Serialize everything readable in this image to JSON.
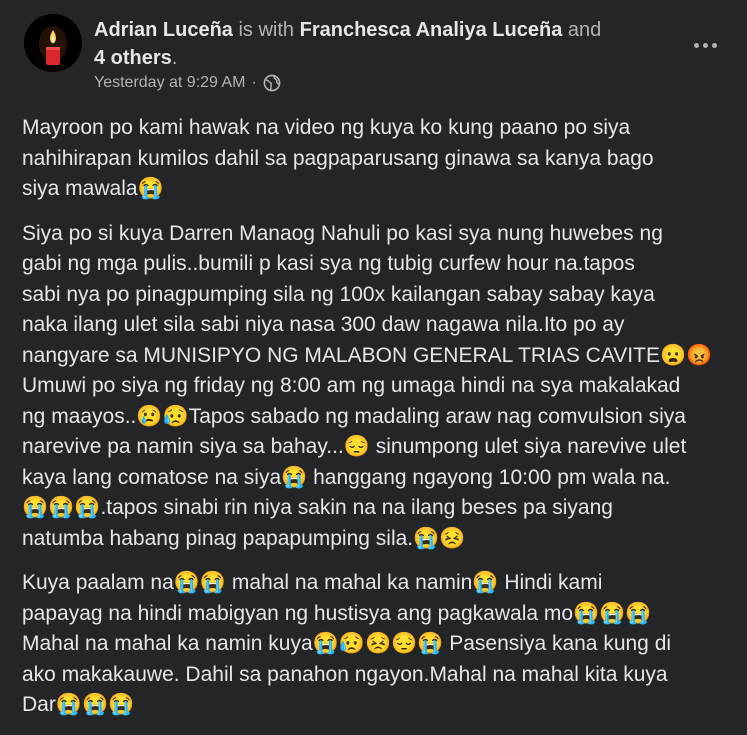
{
  "header": {
    "author": "Adrian Luceña",
    "with_text": " is with ",
    "tagged": "Franchesca Analiya Luceña",
    "and_text": " and ",
    "others": "4 others",
    "period": ".",
    "timestamp": "Yesterday at 9:29 AM",
    "separator": "·",
    "privacy_icon": "globe-icon",
    "more_icon": "more-options-icon"
  },
  "paragraphs": [
    {
      "lines": [
        "Mayroon po kami hawak na video ng kuya ko kung paano po siya",
        "nahihirapan kumilos dahil sa pagpaparusang ginawa sa kanya bago",
        "siya mawala😭"
      ]
    },
    {
      "lines": [
        "Siya po si kuya Darren Manaog Nahuli po kasi sya nung huwebes ng",
        "gabi ng mga pulis..bumili p kasi sya ng tubig curfew hour na.tapos",
        "sabi nya po pinagpumping sila ng 100x kailangan sabay sabay kaya",
        "naka ilang ulet sila sabi niya nasa 300 daw nagawa nila.Ito po ay",
        "nangyare sa MUNISIPYO NG MALABON GENERAL TRIAS CAVITE😦😡",
        "Umuwi po siya ng friday ng 8:00 am ng umaga hindi na sya makalakad",
        "ng maayos..😢😥Tapos sabado ng madaling araw nag comvulsion siya",
        "narevive pa namin siya sa bahay...😔 sinumpong ulet siya narevive ulet",
        "kaya lang comatose na siya😭 hanggang ngayong 10:00 pm wala na.",
        "😭😭😭.tapos sinabi rin niya sakin na na ilang beses pa siyang",
        "natumba habang pinag papapumping sila.😭😣"
      ]
    },
    {
      "lines": [
        "Kuya paalam na😭😭 mahal na mahal ka namin😭 Hindi kami",
        "papayag na hindi mabigyan ng hustisya ang pagkawala mo😭😭😭",
        "Mahal na mahal ka namin kuya😭😥😣😔😭 Pasensiya kana kung di",
        "ako makakauwe. Dahil sa panahon ngayon.Mahal na mahal kita kuya",
        "Dar😭😭😭"
      ]
    }
  ]
}
